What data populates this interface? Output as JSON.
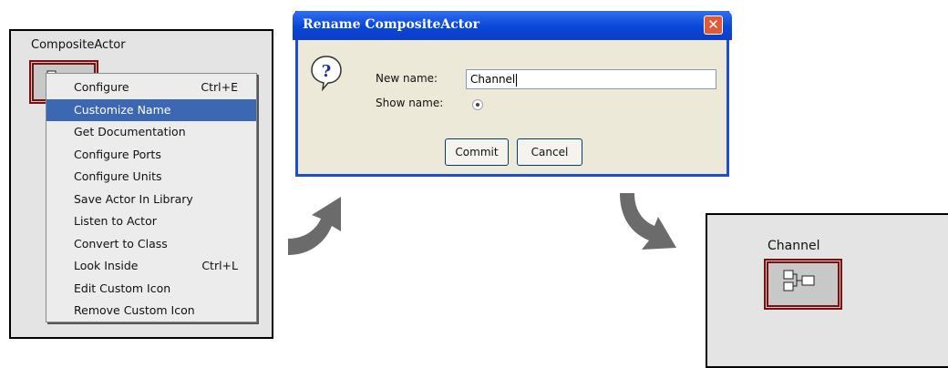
{
  "left_panel": {
    "title": "CompositeActor"
  },
  "context_menu": {
    "items": [
      {
        "label": "Configure",
        "shortcut": "Ctrl+E"
      },
      {
        "label": "Customize Name",
        "shortcut": ""
      },
      {
        "label": "Get Documentation",
        "shortcut": ""
      },
      {
        "label": "Configure Ports",
        "shortcut": ""
      },
      {
        "label": "Configure Units",
        "shortcut": ""
      },
      {
        "label": "Save Actor In Library",
        "shortcut": ""
      },
      {
        "label": "Listen to Actor",
        "shortcut": ""
      },
      {
        "label": "Convert to Class",
        "shortcut": ""
      },
      {
        "label": "Look Inside",
        "shortcut": "Ctrl+L"
      },
      {
        "label": "Edit Custom Icon",
        "shortcut": ""
      },
      {
        "label": "Remove Custom Icon",
        "shortcut": ""
      }
    ],
    "selected_label": "Customize Name"
  },
  "dialog": {
    "title": "Rename CompositeActor",
    "new_name_label": "New name:",
    "new_name_value": "Channel",
    "show_name_label": "Show name:",
    "commit_label": "Commit",
    "cancel_label": "Cancel",
    "close_glyph": "✕"
  },
  "right_panel": {
    "title": "Channel"
  },
  "colors": {
    "selection": "#3b67b3",
    "titlebar": "#0a46d8",
    "actor_border": "#7a1010",
    "arrow": "#6b6b6b"
  }
}
